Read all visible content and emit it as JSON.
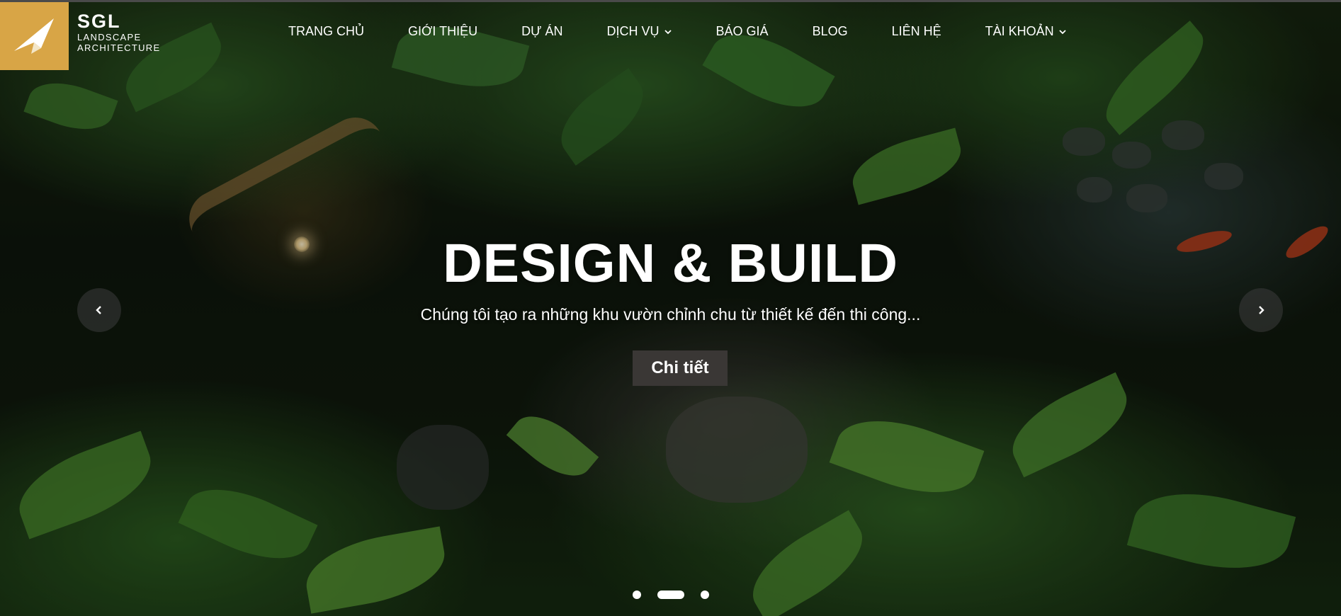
{
  "brand": {
    "name": "SGL",
    "tagline_line1": "LANDSCAPE",
    "tagline_line2": "ARCHITECTURE",
    "logo_color": "#d8a546"
  },
  "nav": {
    "items": [
      {
        "label": "TRANG CHỦ",
        "has_dropdown": false
      },
      {
        "label": "GIỚI THIỆU",
        "has_dropdown": false
      },
      {
        "label": "DỰ ÁN",
        "has_dropdown": false
      },
      {
        "label": "DỊCH VỤ",
        "has_dropdown": true
      },
      {
        "label": "BÁO GIÁ",
        "has_dropdown": false
      },
      {
        "label": "BLOG",
        "has_dropdown": false
      },
      {
        "label": "LIÊN HỆ",
        "has_dropdown": false
      },
      {
        "label": "TÀI KHOẢN",
        "has_dropdown": true
      }
    ]
  },
  "hero": {
    "title": "DESIGN & BUILD",
    "subtitle": "Chúng tôi tạo ra những khu vườn chỉnh chu từ thiết kế đến thi công...",
    "cta_label": "Chi tiết",
    "cta_color": "#3a3735"
  },
  "carousel": {
    "prev_icon": "chevron-left-icon",
    "next_icon": "chevron-right-icon",
    "slide_count": 3,
    "active_index": 1
  }
}
